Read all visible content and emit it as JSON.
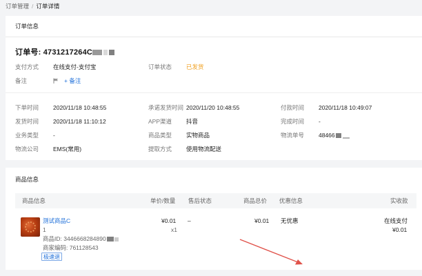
{
  "breadcrumb": {
    "parent": "订单管理",
    "separator": "/",
    "current": "订单详情"
  },
  "order_section": {
    "title": "订单信息",
    "order_no_label": "订单号:",
    "order_no": "4731217264C",
    "payment_method": {
      "label": "支付方式",
      "value": "在线支付-支付宝"
    },
    "order_status": {
      "label": "订单状态",
      "value": "已发货"
    },
    "remark": {
      "label": "备注",
      "add_label": "+ 备注"
    },
    "details": [
      [
        {
          "label": "下单时间",
          "value": "2020/11/18 10:48:55"
        },
        {
          "label": "承诺发货时间",
          "value": "2020/11/20 10:48:55"
        },
        {
          "label": "付款时间",
          "value": "2020/11/18 10:49:07"
        }
      ],
      [
        {
          "label": "发货时间",
          "value": "2020/11/18 11:10:12"
        },
        {
          "label": "APP渠道",
          "value": "抖音"
        },
        {
          "label": "完成时间",
          "value": "-"
        }
      ],
      [
        {
          "label": "业务类型",
          "value": "-"
        },
        {
          "label": "商品类型",
          "value": "实物商品"
        },
        {
          "label": "物流单号",
          "value": "48466"
        }
      ],
      [
        {
          "label": "物流公司",
          "value": "EMS(常用)"
        },
        {
          "label": "提取方式",
          "value": "使用物流配送"
        }
      ]
    ]
  },
  "goods_section": {
    "title": "商品信息",
    "columns": [
      "商品信息",
      "单价/数量",
      "售后状态",
      "商品总价",
      "优惠信息",
      "实收款"
    ],
    "item": {
      "name": "测试商品C",
      "qty_line": "1",
      "product_id": "商品ID: 3446668284890",
      "merchant_code": "商家编码: 761128543",
      "tag": "极速退",
      "unit_price": "¥0.01",
      "quantity": "x1",
      "after_sale": "–",
      "total": "¥0.01",
      "discount": "无优惠",
      "pay_type": "在线支付",
      "received": "¥0.01"
    }
  },
  "colors": {
    "status_orange": "#f0a020",
    "link_blue": "#1e6fd9",
    "arrow_red": "#e0524a"
  },
  "icons": {
    "flag": "flag-icon",
    "arrow": "annotation-arrow"
  }
}
